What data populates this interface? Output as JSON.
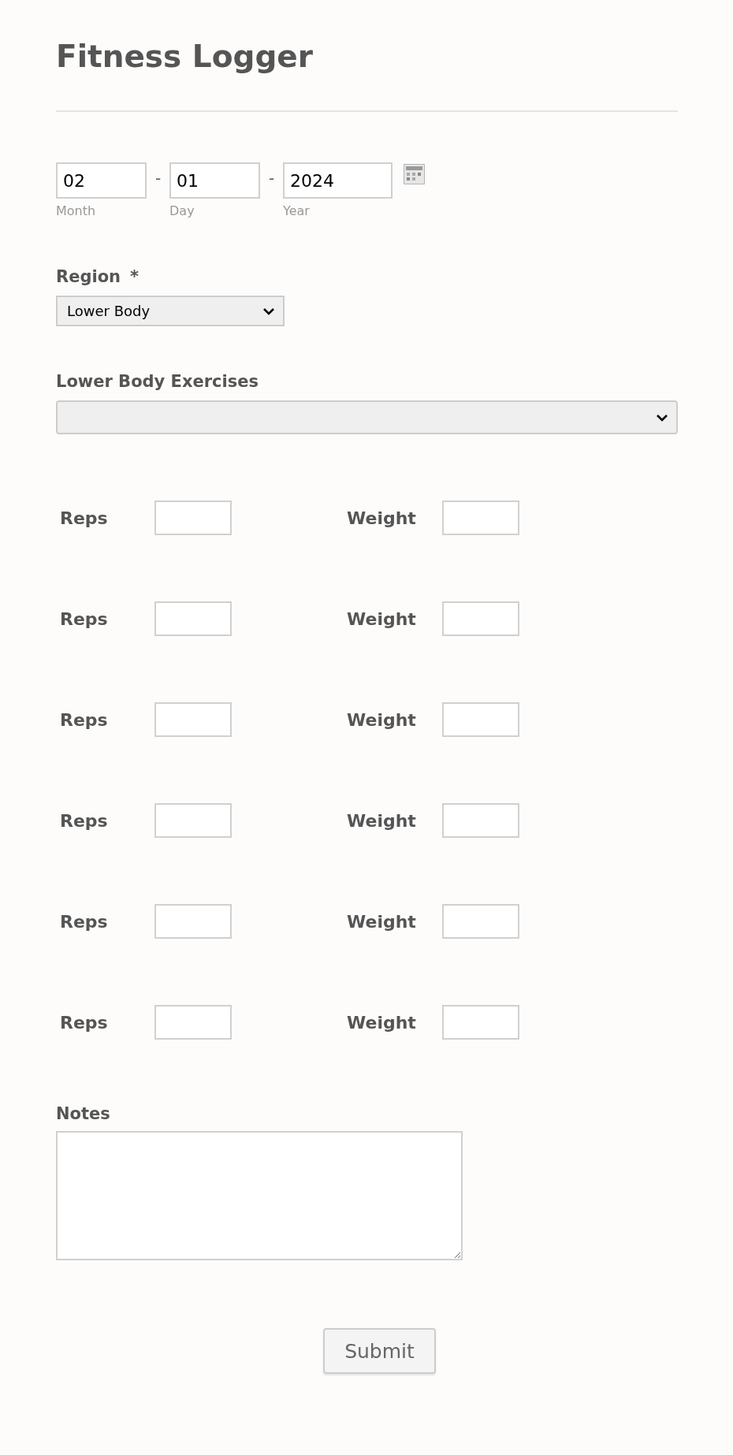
{
  "title": "Fitness Logger",
  "date": {
    "fields": [
      {
        "value": "02",
        "label": "Month"
      },
      {
        "value": "01",
        "label": "Day"
      },
      {
        "value": "2024",
        "label": "Year"
      }
    ],
    "separator": "-"
  },
  "region": {
    "label": "Region",
    "required_mark": "*",
    "value": "Lower Body"
  },
  "exercises": {
    "label": "Lower Body Exercises"
  },
  "sets": [
    {
      "reps_label": "Reps",
      "weight_label": "Weight"
    },
    {
      "reps_label": "Reps",
      "weight_label": "Weight"
    },
    {
      "reps_label": "Reps",
      "weight_label": "Weight"
    },
    {
      "reps_label": "Reps",
      "weight_label": "Weight"
    },
    {
      "reps_label": "Reps",
      "weight_label": "Weight"
    },
    {
      "reps_label": "Reps",
      "weight_label": "Weight"
    }
  ],
  "notes": {
    "label": "Notes"
  },
  "submit": "Submit"
}
